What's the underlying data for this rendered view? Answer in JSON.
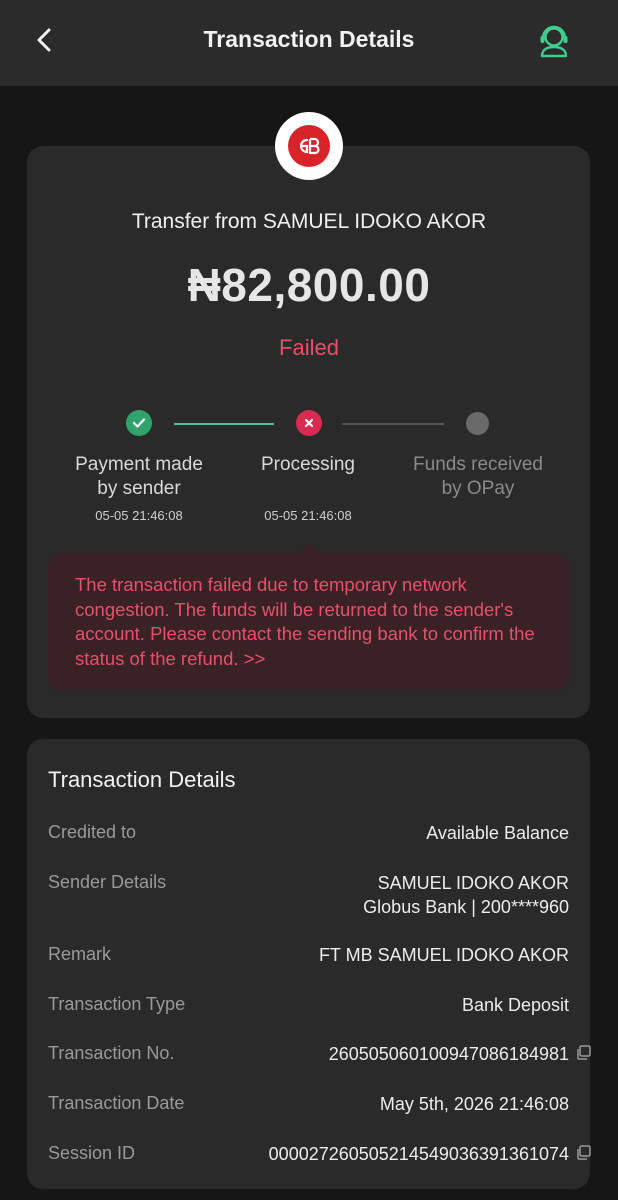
{
  "header": {
    "title": "Transaction Details"
  },
  "summary": {
    "transfer_from": "Transfer from SAMUEL IDOKO AKOR",
    "amount": "₦82,800.00",
    "status": "Failed"
  },
  "steps": [
    {
      "label_line1": "Payment made",
      "label_line2": "by sender",
      "time": "05-05 21:46:08",
      "state": "done"
    },
    {
      "label_line1": "Processing",
      "label_line2": "",
      "time": "05-05 21:46:08",
      "state": "failed"
    },
    {
      "label_line1": "Funds received",
      "label_line2": "by OPay",
      "time": "",
      "state": "pending"
    }
  ],
  "error_message": "The transaction failed due to temporary network congestion. The funds will be returned to the sender's account. Please contact the sending bank to confirm the status of the refund. >>",
  "details": {
    "heading": "Transaction Details",
    "rows": [
      {
        "label": "Credited to",
        "value": "Available Balance"
      },
      {
        "label": "Sender Details",
        "value": "SAMUEL IDOKO AKOR",
        "value2": "Globus Bank | 200****960"
      },
      {
        "label": "Remark",
        "value": "FT MB SAMUEL IDOKO AKOR"
      },
      {
        "label": "Transaction Type",
        "value": "Bank Deposit"
      },
      {
        "label": "Transaction No.",
        "value": "260505060100947086184981"
      },
      {
        "label": "Transaction Date",
        "value": "May 5th, 2026 21:46:08"
      },
      {
        "label": "Session ID",
        "value": "000027260505214549036391361074"
      }
    ]
  },
  "colors": {
    "success": "#2fa36b",
    "failure": "#e8506a",
    "support_icon": "#3ecf8e"
  },
  "icons": {
    "back": "chevron-left-icon",
    "support": "customer-support-icon",
    "copy": "copy-icon",
    "bank_logo": "globus-bank-logo"
  }
}
